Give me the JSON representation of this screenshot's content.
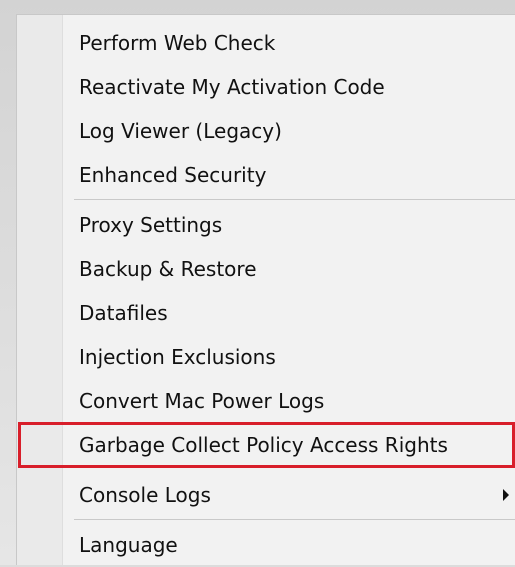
{
  "context_menu": {
    "items": [
      {
        "label": "Perform Web Check"
      },
      {
        "label": "Reactivate My Activation Code"
      },
      {
        "label": "Log Viewer (Legacy)"
      },
      {
        "label": "Enhanced Security"
      },
      {
        "label": "Proxy Settings"
      },
      {
        "label": "Backup & Restore"
      },
      {
        "label": "Datafiles"
      },
      {
        "label": "Injection Exclusions"
      },
      {
        "label": "Convert Mac Power Logs"
      },
      {
        "label": "Garbage Collect Policy Access Rights"
      },
      {
        "label": "Console Logs"
      },
      {
        "label": "Language"
      }
    ],
    "highlight_color": "#d81e2a",
    "submenu_icon": "chevron-right-icon"
  }
}
